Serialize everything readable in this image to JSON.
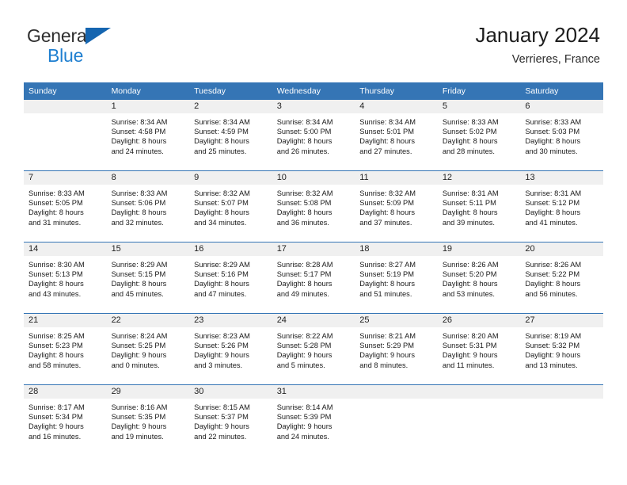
{
  "brand": {
    "word_one": "General",
    "word_two": "Blue",
    "triangle_color": "#1565b0",
    "blue_color": "#1f7fd0"
  },
  "header": {
    "title": "January 2024",
    "subtitle": "Verrieres, France"
  },
  "theme": {
    "header_row_bg": "#3575b5",
    "daynum_band_bg": "#f0f0f0",
    "week_divider": "#3575b5"
  },
  "calendar": {
    "weekday_headers": [
      "Sunday",
      "Monday",
      "Tuesday",
      "Wednesday",
      "Thursday",
      "Friday",
      "Saturday"
    ],
    "weeks": [
      [
        {
          "day": "",
          "sunrise": "",
          "sunset": "",
          "daylight_line1": "",
          "daylight_line2": ""
        },
        {
          "day": "1",
          "sunrise": "Sunrise: 8:34 AM",
          "sunset": "Sunset: 4:58 PM",
          "daylight_line1": "Daylight: 8 hours",
          "daylight_line2": "and 24 minutes."
        },
        {
          "day": "2",
          "sunrise": "Sunrise: 8:34 AM",
          "sunset": "Sunset: 4:59 PM",
          "daylight_line1": "Daylight: 8 hours",
          "daylight_line2": "and 25 minutes."
        },
        {
          "day": "3",
          "sunrise": "Sunrise: 8:34 AM",
          "sunset": "Sunset: 5:00 PM",
          "daylight_line1": "Daylight: 8 hours",
          "daylight_line2": "and 26 minutes."
        },
        {
          "day": "4",
          "sunrise": "Sunrise: 8:34 AM",
          "sunset": "Sunset: 5:01 PM",
          "daylight_line1": "Daylight: 8 hours",
          "daylight_line2": "and 27 minutes."
        },
        {
          "day": "5",
          "sunrise": "Sunrise: 8:33 AM",
          "sunset": "Sunset: 5:02 PM",
          "daylight_line1": "Daylight: 8 hours",
          "daylight_line2": "and 28 minutes."
        },
        {
          "day": "6",
          "sunrise": "Sunrise: 8:33 AM",
          "sunset": "Sunset: 5:03 PM",
          "daylight_line1": "Daylight: 8 hours",
          "daylight_line2": "and 30 minutes."
        }
      ],
      [
        {
          "day": "7",
          "sunrise": "Sunrise: 8:33 AM",
          "sunset": "Sunset: 5:05 PM",
          "daylight_line1": "Daylight: 8 hours",
          "daylight_line2": "and 31 minutes."
        },
        {
          "day": "8",
          "sunrise": "Sunrise: 8:33 AM",
          "sunset": "Sunset: 5:06 PM",
          "daylight_line1": "Daylight: 8 hours",
          "daylight_line2": "and 32 minutes."
        },
        {
          "day": "9",
          "sunrise": "Sunrise: 8:32 AM",
          "sunset": "Sunset: 5:07 PM",
          "daylight_line1": "Daylight: 8 hours",
          "daylight_line2": "and 34 minutes."
        },
        {
          "day": "10",
          "sunrise": "Sunrise: 8:32 AM",
          "sunset": "Sunset: 5:08 PM",
          "daylight_line1": "Daylight: 8 hours",
          "daylight_line2": "and 36 minutes."
        },
        {
          "day": "11",
          "sunrise": "Sunrise: 8:32 AM",
          "sunset": "Sunset: 5:09 PM",
          "daylight_line1": "Daylight: 8 hours",
          "daylight_line2": "and 37 minutes."
        },
        {
          "day": "12",
          "sunrise": "Sunrise: 8:31 AM",
          "sunset": "Sunset: 5:11 PM",
          "daylight_line1": "Daylight: 8 hours",
          "daylight_line2": "and 39 minutes."
        },
        {
          "day": "13",
          "sunrise": "Sunrise: 8:31 AM",
          "sunset": "Sunset: 5:12 PM",
          "daylight_line1": "Daylight: 8 hours",
          "daylight_line2": "and 41 minutes."
        }
      ],
      [
        {
          "day": "14",
          "sunrise": "Sunrise: 8:30 AM",
          "sunset": "Sunset: 5:13 PM",
          "daylight_line1": "Daylight: 8 hours",
          "daylight_line2": "and 43 minutes."
        },
        {
          "day": "15",
          "sunrise": "Sunrise: 8:29 AM",
          "sunset": "Sunset: 5:15 PM",
          "daylight_line1": "Daylight: 8 hours",
          "daylight_line2": "and 45 minutes."
        },
        {
          "day": "16",
          "sunrise": "Sunrise: 8:29 AM",
          "sunset": "Sunset: 5:16 PM",
          "daylight_line1": "Daylight: 8 hours",
          "daylight_line2": "and 47 minutes."
        },
        {
          "day": "17",
          "sunrise": "Sunrise: 8:28 AM",
          "sunset": "Sunset: 5:17 PM",
          "daylight_line1": "Daylight: 8 hours",
          "daylight_line2": "and 49 minutes."
        },
        {
          "day": "18",
          "sunrise": "Sunrise: 8:27 AM",
          "sunset": "Sunset: 5:19 PM",
          "daylight_line1": "Daylight: 8 hours",
          "daylight_line2": "and 51 minutes."
        },
        {
          "day": "19",
          "sunrise": "Sunrise: 8:26 AM",
          "sunset": "Sunset: 5:20 PM",
          "daylight_line1": "Daylight: 8 hours",
          "daylight_line2": "and 53 minutes."
        },
        {
          "day": "20",
          "sunrise": "Sunrise: 8:26 AM",
          "sunset": "Sunset: 5:22 PM",
          "daylight_line1": "Daylight: 8 hours",
          "daylight_line2": "and 56 minutes."
        }
      ],
      [
        {
          "day": "21",
          "sunrise": "Sunrise: 8:25 AM",
          "sunset": "Sunset: 5:23 PM",
          "daylight_line1": "Daylight: 8 hours",
          "daylight_line2": "and 58 minutes."
        },
        {
          "day": "22",
          "sunrise": "Sunrise: 8:24 AM",
          "sunset": "Sunset: 5:25 PM",
          "daylight_line1": "Daylight: 9 hours",
          "daylight_line2": "and 0 minutes."
        },
        {
          "day": "23",
          "sunrise": "Sunrise: 8:23 AM",
          "sunset": "Sunset: 5:26 PM",
          "daylight_line1": "Daylight: 9 hours",
          "daylight_line2": "and 3 minutes."
        },
        {
          "day": "24",
          "sunrise": "Sunrise: 8:22 AM",
          "sunset": "Sunset: 5:28 PM",
          "daylight_line1": "Daylight: 9 hours",
          "daylight_line2": "and 5 minutes."
        },
        {
          "day": "25",
          "sunrise": "Sunrise: 8:21 AM",
          "sunset": "Sunset: 5:29 PM",
          "daylight_line1": "Daylight: 9 hours",
          "daylight_line2": "and 8 minutes."
        },
        {
          "day": "26",
          "sunrise": "Sunrise: 8:20 AM",
          "sunset": "Sunset: 5:31 PM",
          "daylight_line1": "Daylight: 9 hours",
          "daylight_line2": "and 11 minutes."
        },
        {
          "day": "27",
          "sunrise": "Sunrise: 8:19 AM",
          "sunset": "Sunset: 5:32 PM",
          "daylight_line1": "Daylight: 9 hours",
          "daylight_line2": "and 13 minutes."
        }
      ],
      [
        {
          "day": "28",
          "sunrise": "Sunrise: 8:17 AM",
          "sunset": "Sunset: 5:34 PM",
          "daylight_line1": "Daylight: 9 hours",
          "daylight_line2": "and 16 minutes."
        },
        {
          "day": "29",
          "sunrise": "Sunrise: 8:16 AM",
          "sunset": "Sunset: 5:35 PM",
          "daylight_line1": "Daylight: 9 hours",
          "daylight_line2": "and 19 minutes."
        },
        {
          "day": "30",
          "sunrise": "Sunrise: 8:15 AM",
          "sunset": "Sunset: 5:37 PM",
          "daylight_line1": "Daylight: 9 hours",
          "daylight_line2": "and 22 minutes."
        },
        {
          "day": "31",
          "sunrise": "Sunrise: 8:14 AM",
          "sunset": "Sunset: 5:39 PM",
          "daylight_line1": "Daylight: 9 hours",
          "daylight_line2": "and 24 minutes."
        },
        {
          "day": "",
          "sunrise": "",
          "sunset": "",
          "daylight_line1": "",
          "daylight_line2": ""
        },
        {
          "day": "",
          "sunrise": "",
          "sunset": "",
          "daylight_line1": "",
          "daylight_line2": ""
        },
        {
          "day": "",
          "sunrise": "",
          "sunset": "",
          "daylight_line1": "",
          "daylight_line2": ""
        }
      ]
    ]
  }
}
